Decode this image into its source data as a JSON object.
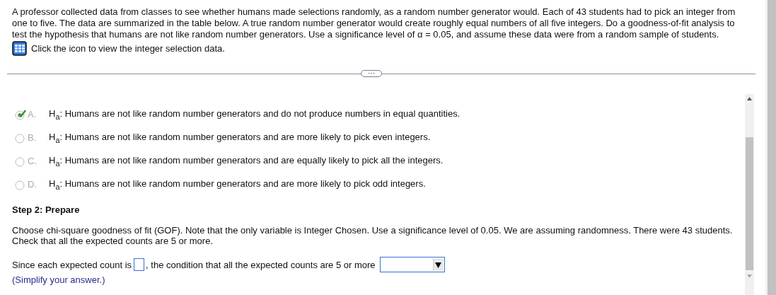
{
  "question": {
    "text": "A professor collected data from classes to see whether humans made selections randomly, as a random number generator would. Each of 43 students had to pick an integer from one to five. The data are summarized in the table below. A true random number generator would create roughly equal numbers of all five integers. Do a goodness-of-fit analysis to test the hypothesis that humans are not like random number generators. Use a significance level of α = 0.05, and assume these data were from a random sample of students.",
    "data_link": "Click the icon to view the integer selection data."
  },
  "divider_handle": "···",
  "options": [
    {
      "letter": "A.",
      "text": "H$_{a}$: Humans are not like random number generators and do not produce numbers in equal quantities.",
      "selected": true,
      "correct": true
    },
    {
      "letter": "B.",
      "text": "H$_{a}$: Humans are not like random number generators and are more likely to pick even integers.",
      "selected": false,
      "correct": false
    },
    {
      "letter": "C.",
      "text": "H$_{a}$: Humans are not like random number generators and are equally likely to pick all the integers.",
      "selected": false,
      "correct": false
    },
    {
      "letter": "D.",
      "text": "H$_{a}$: Humans are not like random number generators and are more likely to pick odd integers.",
      "selected": false,
      "correct": false
    }
  ],
  "step": {
    "title": "Step 2: Prepare",
    "lines": [
      "Choose chi-square goodness of fit (GOF). Note that the only variable is Integer Chosen. Use a significance level of 0.05. We are assuming randomness. There were 43 students.",
      "Check that all the expected counts are 5 or more."
    ],
    "answer": {
      "prefix": "Since each expected count is",
      "after_input": ", the condition that all the expected counts are 5 or more"
    },
    "hint": "(Simplify your answer.)"
  }
}
